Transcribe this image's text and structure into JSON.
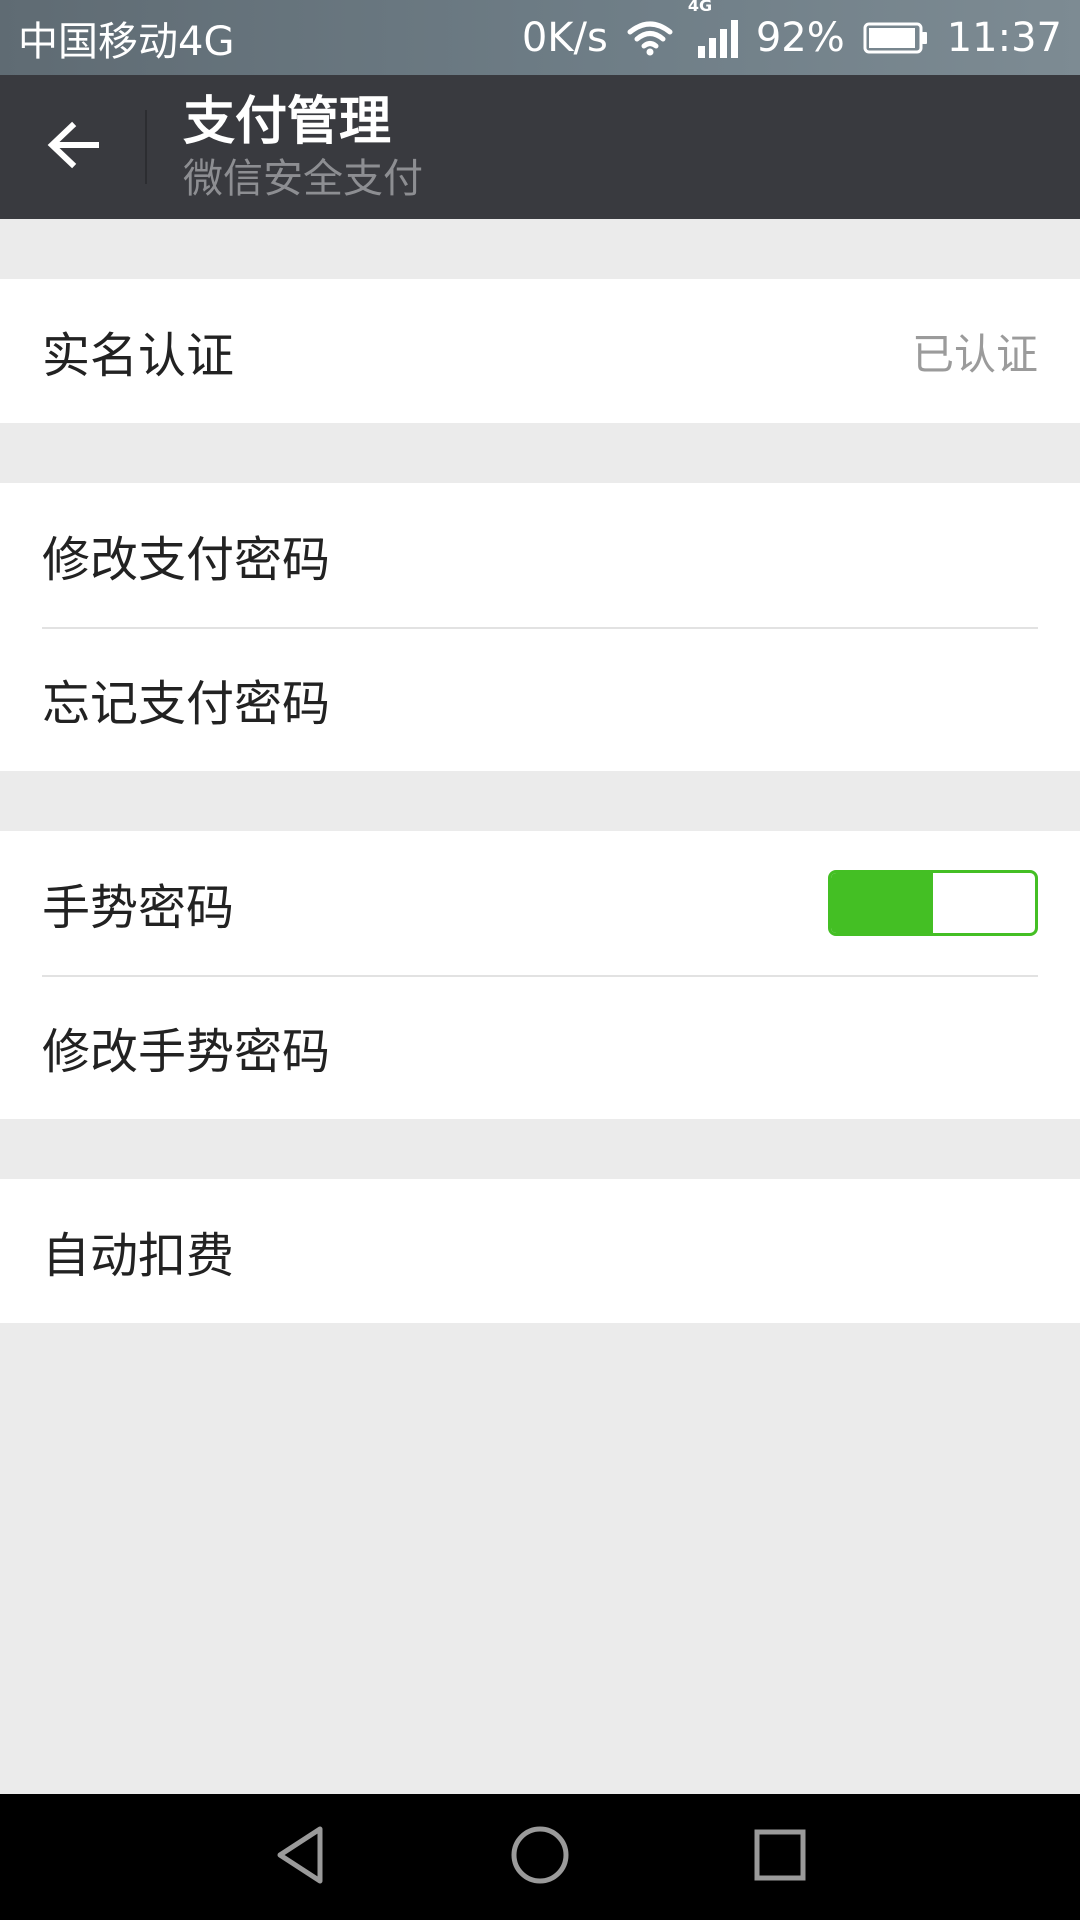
{
  "status_bar": {
    "carrier": "中国移动4G",
    "net_speed": "0K/s",
    "network_type": "4G",
    "battery": "92%",
    "time": "11:37"
  },
  "header": {
    "title": "支付管理",
    "subtitle": "微信安全支付"
  },
  "groups": [
    {
      "items": [
        {
          "label": "实名认证",
          "value": "已认证"
        }
      ]
    },
    {
      "items": [
        {
          "label": "修改支付密码"
        },
        {
          "label": "忘记支付密码"
        }
      ]
    },
    {
      "items": [
        {
          "label": "手势密码",
          "toggle_on": true,
          "toggle_fill_fraction": 0.5
        },
        {
          "label": "修改手势密码"
        }
      ]
    },
    {
      "items": [
        {
          "label": "自动扣费"
        }
      ]
    }
  ],
  "colors": {
    "toggle_accent": "#44bf24",
    "header_bg": "#393a3f"
  },
  "icons": {
    "back": "arrow-left-icon",
    "nav_back": "triangle-back-icon",
    "nav_home": "circle-home-icon",
    "nav_recents": "square-recents-icon"
  }
}
